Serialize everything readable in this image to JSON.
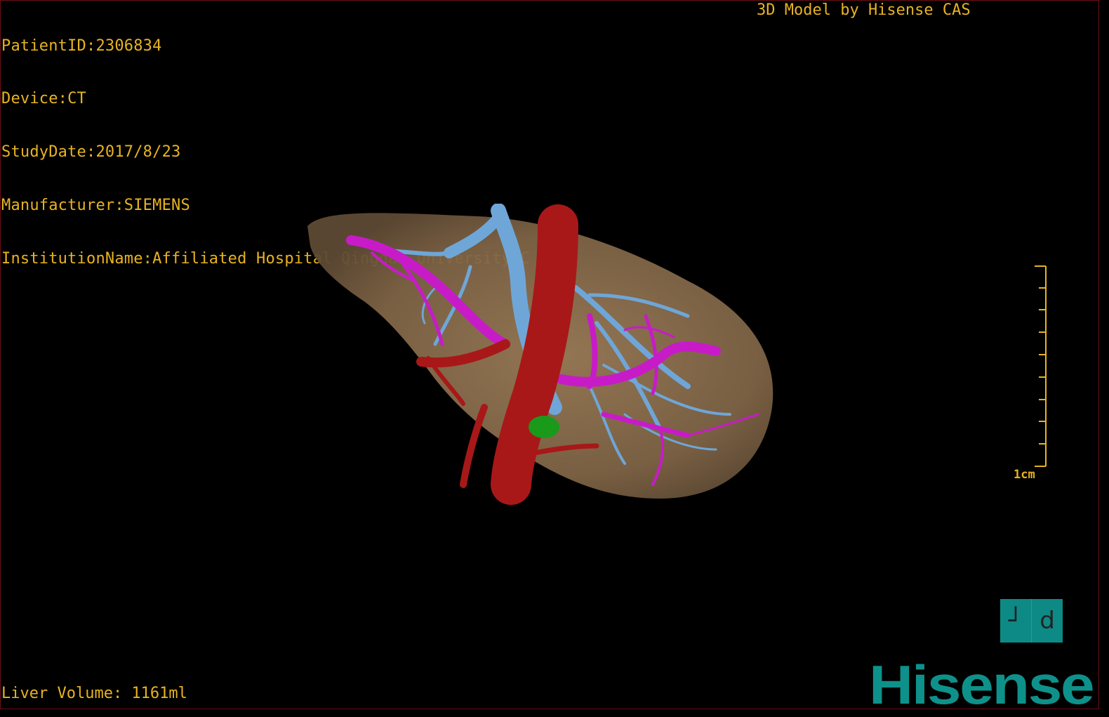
{
  "header": {
    "patient_id": "PatientID:2306834",
    "device": "Device:CT",
    "study_date": "StudyDate:2017/8/23",
    "manufacturer": "Manufacturer:SIEMENS",
    "institution": "InstitutionName:Affiliated Hospital Qingdao University-C",
    "credit": "3D Model by Hisense CAS"
  },
  "footer": {
    "liver_volume": "Liver Volume: 1161ml"
  },
  "scale_bar": {
    "label": "1cm"
  },
  "orientation": {
    "left_glyph": "┘",
    "right_glyph": "d"
  },
  "brand": {
    "logo_text": "Hisense"
  },
  "colors": {
    "text": "#e8b321",
    "liver": "#8a6e4e",
    "portal_vein": "#c81bc8",
    "hepatic_vein": "#6fa6d8",
    "artery": "#a81818",
    "gallbladder": "#1a9a1a",
    "brand": "#0e918a"
  }
}
